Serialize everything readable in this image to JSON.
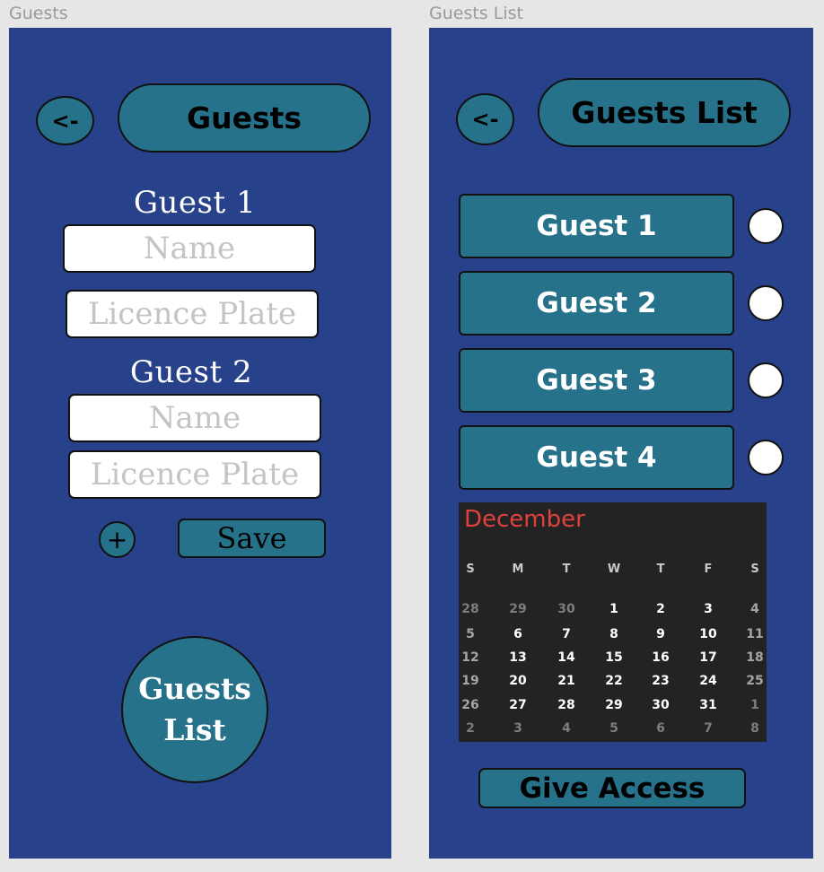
{
  "left_artboard": {
    "label": "Guests",
    "back_button": "<-",
    "title": "Guests",
    "guests": [
      {
        "label": "Guest 1",
        "name_placeholder": "Name",
        "plate_placeholder": "Licence Plate"
      },
      {
        "label": "Guest 2",
        "name_placeholder": "Name",
        "plate_placeholder": "Licence Plate"
      }
    ],
    "add_button": "+",
    "save_button": "Save",
    "guests_list_button": {
      "line1": "Guests",
      "line2": "List"
    }
  },
  "right_artboard": {
    "label": "Guests List",
    "back_button": "<-",
    "title": "Guests List",
    "guest_items": [
      "Guest 1",
      "Guest 2",
      "Guest 3",
      "Guest 4"
    ],
    "calendar": {
      "month": "December",
      "weekdays": [
        "S",
        "M",
        "T",
        "W",
        "T",
        "F",
        "S"
      ],
      "weeks": [
        [
          "28",
          "29",
          "30",
          "1",
          "2",
          "3",
          "4"
        ],
        [
          "5",
          "6",
          "7",
          "8",
          "9",
          "10",
          "11"
        ],
        [
          "12",
          "13",
          "14",
          "15",
          "16",
          "17",
          "18"
        ],
        [
          "19",
          "20",
          "21",
          "22",
          "23",
          "24",
          "25"
        ],
        [
          "26",
          "27",
          "28",
          "29",
          "30",
          "31",
          "1"
        ],
        [
          "2",
          "3",
          "4",
          "5",
          "6",
          "7",
          "8"
        ]
      ]
    },
    "give_access_button": "Give Access"
  },
  "colors": {
    "screen_bg": "#27418a",
    "accent": "#26728a",
    "calendar_bg": "#232323",
    "month_red": "#e0413c",
    "canvas": "#e6e6e6"
  }
}
